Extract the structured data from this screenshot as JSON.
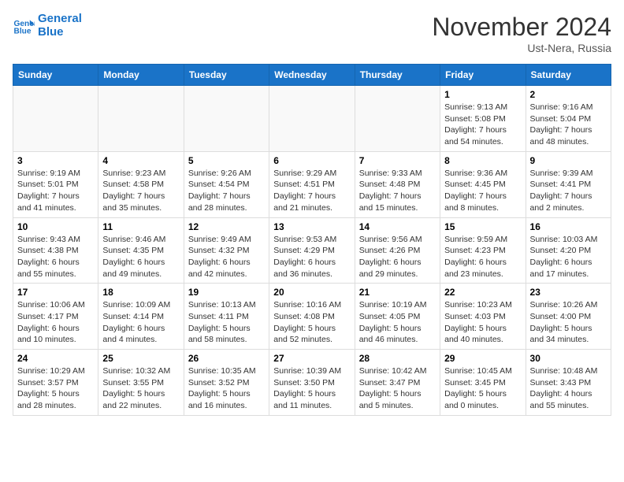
{
  "logo": {
    "line1": "General",
    "line2": "Blue"
  },
  "title": "November 2024",
  "subtitle": "Ust-Nera, Russia",
  "weekdays": [
    "Sunday",
    "Monday",
    "Tuesday",
    "Wednesday",
    "Thursday",
    "Friday",
    "Saturday"
  ],
  "weeks": [
    [
      {
        "day": "",
        "info": "",
        "empty": true
      },
      {
        "day": "",
        "info": "",
        "empty": true
      },
      {
        "day": "",
        "info": "",
        "empty": true
      },
      {
        "day": "",
        "info": "",
        "empty": true
      },
      {
        "day": "",
        "info": "",
        "empty": true
      },
      {
        "day": "1",
        "info": "Sunrise: 9:13 AM\nSunset: 5:08 PM\nDaylight: 7 hours\nand 54 minutes.",
        "empty": false
      },
      {
        "day": "2",
        "info": "Sunrise: 9:16 AM\nSunset: 5:04 PM\nDaylight: 7 hours\nand 48 minutes.",
        "empty": false
      }
    ],
    [
      {
        "day": "3",
        "info": "Sunrise: 9:19 AM\nSunset: 5:01 PM\nDaylight: 7 hours\nand 41 minutes.",
        "empty": false
      },
      {
        "day": "4",
        "info": "Sunrise: 9:23 AM\nSunset: 4:58 PM\nDaylight: 7 hours\nand 35 minutes.",
        "empty": false
      },
      {
        "day": "5",
        "info": "Sunrise: 9:26 AM\nSunset: 4:54 PM\nDaylight: 7 hours\nand 28 minutes.",
        "empty": false
      },
      {
        "day": "6",
        "info": "Sunrise: 9:29 AM\nSunset: 4:51 PM\nDaylight: 7 hours\nand 21 minutes.",
        "empty": false
      },
      {
        "day": "7",
        "info": "Sunrise: 9:33 AM\nSunset: 4:48 PM\nDaylight: 7 hours\nand 15 minutes.",
        "empty": false
      },
      {
        "day": "8",
        "info": "Sunrise: 9:36 AM\nSunset: 4:45 PM\nDaylight: 7 hours\nand 8 minutes.",
        "empty": false
      },
      {
        "day": "9",
        "info": "Sunrise: 9:39 AM\nSunset: 4:41 PM\nDaylight: 7 hours\nand 2 minutes.",
        "empty": false
      }
    ],
    [
      {
        "day": "10",
        "info": "Sunrise: 9:43 AM\nSunset: 4:38 PM\nDaylight: 6 hours\nand 55 minutes.",
        "empty": false
      },
      {
        "day": "11",
        "info": "Sunrise: 9:46 AM\nSunset: 4:35 PM\nDaylight: 6 hours\nand 49 minutes.",
        "empty": false
      },
      {
        "day": "12",
        "info": "Sunrise: 9:49 AM\nSunset: 4:32 PM\nDaylight: 6 hours\nand 42 minutes.",
        "empty": false
      },
      {
        "day": "13",
        "info": "Sunrise: 9:53 AM\nSunset: 4:29 PM\nDaylight: 6 hours\nand 36 minutes.",
        "empty": false
      },
      {
        "day": "14",
        "info": "Sunrise: 9:56 AM\nSunset: 4:26 PM\nDaylight: 6 hours\nand 29 minutes.",
        "empty": false
      },
      {
        "day": "15",
        "info": "Sunrise: 9:59 AM\nSunset: 4:23 PM\nDaylight: 6 hours\nand 23 minutes.",
        "empty": false
      },
      {
        "day": "16",
        "info": "Sunrise: 10:03 AM\nSunset: 4:20 PM\nDaylight: 6 hours\nand 17 minutes.",
        "empty": false
      }
    ],
    [
      {
        "day": "17",
        "info": "Sunrise: 10:06 AM\nSunset: 4:17 PM\nDaylight: 6 hours\nand 10 minutes.",
        "empty": false
      },
      {
        "day": "18",
        "info": "Sunrise: 10:09 AM\nSunset: 4:14 PM\nDaylight: 6 hours\nand 4 minutes.",
        "empty": false
      },
      {
        "day": "19",
        "info": "Sunrise: 10:13 AM\nSunset: 4:11 PM\nDaylight: 5 hours\nand 58 minutes.",
        "empty": false
      },
      {
        "day": "20",
        "info": "Sunrise: 10:16 AM\nSunset: 4:08 PM\nDaylight: 5 hours\nand 52 minutes.",
        "empty": false
      },
      {
        "day": "21",
        "info": "Sunrise: 10:19 AM\nSunset: 4:05 PM\nDaylight: 5 hours\nand 46 minutes.",
        "empty": false
      },
      {
        "day": "22",
        "info": "Sunrise: 10:23 AM\nSunset: 4:03 PM\nDaylight: 5 hours\nand 40 minutes.",
        "empty": false
      },
      {
        "day": "23",
        "info": "Sunrise: 10:26 AM\nSunset: 4:00 PM\nDaylight: 5 hours\nand 34 minutes.",
        "empty": false
      }
    ],
    [
      {
        "day": "24",
        "info": "Sunrise: 10:29 AM\nSunset: 3:57 PM\nDaylight: 5 hours\nand 28 minutes.",
        "empty": false
      },
      {
        "day": "25",
        "info": "Sunrise: 10:32 AM\nSunset: 3:55 PM\nDaylight: 5 hours\nand 22 minutes.",
        "empty": false
      },
      {
        "day": "26",
        "info": "Sunrise: 10:35 AM\nSunset: 3:52 PM\nDaylight: 5 hours\nand 16 minutes.",
        "empty": false
      },
      {
        "day": "27",
        "info": "Sunrise: 10:39 AM\nSunset: 3:50 PM\nDaylight: 5 hours\nand 11 minutes.",
        "empty": false
      },
      {
        "day": "28",
        "info": "Sunrise: 10:42 AM\nSunset: 3:47 PM\nDaylight: 5 hours\nand 5 minutes.",
        "empty": false
      },
      {
        "day": "29",
        "info": "Sunrise: 10:45 AM\nSunset: 3:45 PM\nDaylight: 5 hours\nand 0 minutes.",
        "empty": false
      },
      {
        "day": "30",
        "info": "Sunrise: 10:48 AM\nSunset: 3:43 PM\nDaylight: 4 hours\nand 55 minutes.",
        "empty": false
      }
    ]
  ]
}
